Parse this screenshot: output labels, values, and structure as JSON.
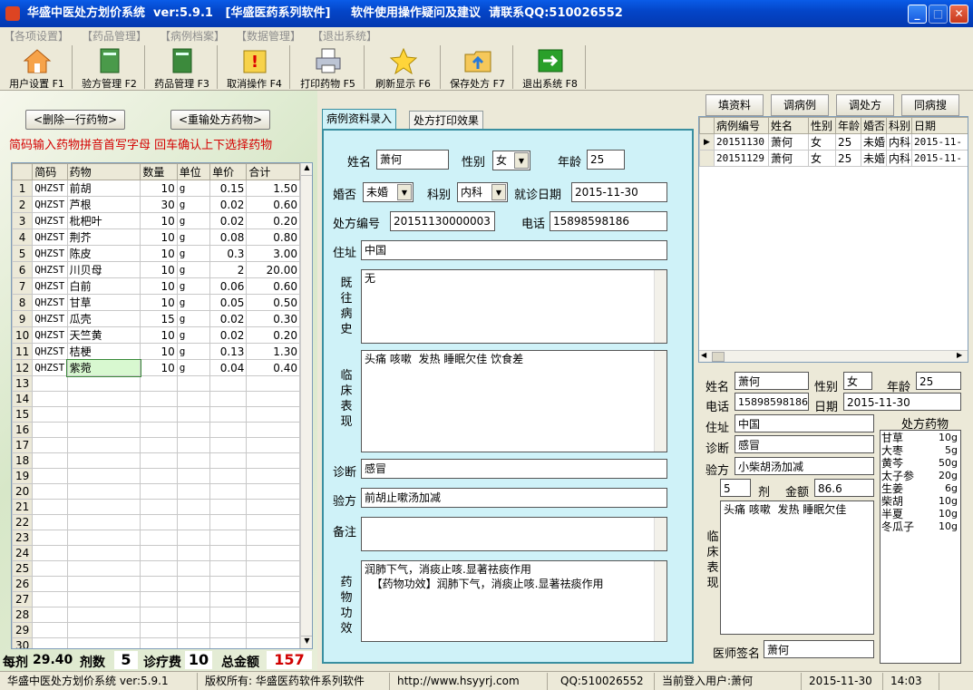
{
  "window": {
    "title": "华盛中医处方划价系统  ver:5.9.1   [华盛医药系列软件]     软件使用操作疑问及建议  请联系QQ:510026552"
  },
  "menu": [
    "【各项设置】",
    "【药品管理】",
    "【病例档案】",
    "【数据管理】",
    "【退出系统】"
  ],
  "toolbar": [
    {
      "label": "用户设置 F1",
      "icon": "home-icon"
    },
    {
      "label": "验方管理 F2",
      "icon": "book-icon"
    },
    {
      "label": "药品管理 F3",
      "icon": "book-icon"
    },
    {
      "label": "取消操作 F4",
      "icon": "warning-icon"
    },
    {
      "label": "打印药物 F5",
      "icon": "printer-icon"
    },
    {
      "label": "刷新显示 F6",
      "icon": "star-icon"
    },
    {
      "label": "保存处方 F7",
      "icon": "folder-icon"
    },
    {
      "label": "退出系统 F8",
      "icon": "exit-icon"
    }
  ],
  "left": {
    "delete_button": "<删除一行药物>",
    "reinput_button": "<重输处方药物>",
    "hint": "简码输入药物拼音首写字母  回车确认上下选择药物",
    "columns": [
      "简码",
      "药物",
      "数量",
      "单位",
      "单价",
      "合计"
    ],
    "rows": [
      {
        "no": "1",
        "code": "QHZST",
        "name": "前胡",
        "qty": "10",
        "unit": "g",
        "price": "0.15",
        "total": "1.50"
      },
      {
        "no": "2",
        "code": "QHZST",
        "name": "芦根",
        "qty": "30",
        "unit": "g",
        "price": "0.02",
        "total": "0.60"
      },
      {
        "no": "3",
        "code": "QHZST",
        "name": "枇杷叶",
        "qty": "10",
        "unit": "g",
        "price": "0.02",
        "total": "0.20"
      },
      {
        "no": "4",
        "code": "QHZST",
        "name": "荆芥",
        "qty": "10",
        "unit": "g",
        "price": "0.08",
        "total": "0.80"
      },
      {
        "no": "5",
        "code": "QHZST",
        "name": "陈皮",
        "qty": "10",
        "unit": "g",
        "price": "0.3",
        "total": "3.00"
      },
      {
        "no": "6",
        "code": "QHZST",
        "name": "川贝母",
        "qty": "10",
        "unit": "g",
        "price": "2",
        "total": "20.00"
      },
      {
        "no": "7",
        "code": "QHZST",
        "name": "白前",
        "qty": "10",
        "unit": "g",
        "price": "0.06",
        "total": "0.60"
      },
      {
        "no": "8",
        "code": "QHZST",
        "name": "甘草",
        "qty": "10",
        "unit": "g",
        "price": "0.05",
        "total": "0.50"
      },
      {
        "no": "9",
        "code": "QHZST",
        "name": "瓜壳",
        "qty": "15",
        "unit": "g",
        "price": "0.02",
        "total": "0.30"
      },
      {
        "no": "10",
        "code": "QHZST",
        "name": "天竺黄",
        "qty": "10",
        "unit": "g",
        "price": "0.02",
        "total": "0.20"
      },
      {
        "no": "11",
        "code": "QHZST",
        "name": "桔梗",
        "qty": "10",
        "unit": "g",
        "price": "0.13",
        "total": "1.30"
      },
      {
        "no": "12",
        "code": "QHZST",
        "name": "紫菀",
        "qty": "10",
        "unit": "g",
        "price": "0.04",
        "total": "0.40"
      }
    ],
    "empty_rows": [
      "13",
      "14",
      "15",
      "16",
      "17",
      "18",
      "19",
      "20",
      "21",
      "22",
      "23",
      "24",
      "25",
      "26",
      "27",
      "28",
      "29",
      "30"
    ],
    "totals": {
      "per_dose_label": "每剂",
      "per_dose": "29.40",
      "doses_label": "剂数",
      "doses": "5",
      "fee_label": "诊疗费",
      "fee": "10",
      "total_label": "总金额",
      "total": "157"
    }
  },
  "mid": {
    "tabs": [
      "病例资料录入",
      "处方打印效果"
    ],
    "labels": {
      "name": "姓名",
      "gender": "性别",
      "age": "年龄",
      "marital": "婚否",
      "dept": "科别",
      "date": "就诊日期",
      "rxno": "处方编号",
      "phone": "电话",
      "address": "住址",
      "history": "既往病史",
      "clinical": "临床表现",
      "diagnosis": "诊断",
      "formula": "验方",
      "remark": "备注",
      "effect": "药物功效"
    },
    "name": "萧何",
    "gender": "女",
    "age": "25",
    "marital": "未婚",
    "dept": "内科",
    "date": "2015-11-30",
    "rxno": "20151130000003",
    "phone": "15898598186",
    "address": "中国",
    "history": "无",
    "clinical": "头痛 咳嗽  发热 睡眠欠佳 饮食差",
    "diagnosis": "感冒",
    "formula": "前胡止嗽汤加减",
    "remark": "",
    "effect": "润肺下气，消痰止咳.显著祛痰作用\n  【药物功效】润肺下气，消痰止咳.显著祛痰作用"
  },
  "right": {
    "tabs": [
      "填资料",
      "调病例",
      "调处方",
      "同病搜"
    ],
    "columns": [
      "病例编号",
      "姓名",
      "性别",
      "年龄",
      "婚否",
      "科别",
      "日期"
    ],
    "rows": [
      {
        "id": "20151130",
        "name": "萧何",
        "gender": "女",
        "age": "25",
        "marital": "未婚",
        "dept": "内科",
        "date": "2015-11-"
      },
      {
        "id": "20151129",
        "name": "萧何",
        "gender": "女",
        "age": "25",
        "marital": "未婚",
        "dept": "内科",
        "date": "2015-11-"
      }
    ],
    "labels": {
      "name": "姓名",
      "gender": "性别",
      "age": "年龄",
      "phone": "电话",
      "date": "日期",
      "address": "住址",
      "diagnosis": "诊断",
      "formula": "验方",
      "doses_unit": "剂",
      "amount": "金额",
      "clinical": "临床表现",
      "doctor": "医师签名",
      "rx_drugs": "处方药物"
    },
    "name": "萧何",
    "gender": "女",
    "age": "25",
    "phone": "15898598186",
    "date": "2015-11-30",
    "address": "中国",
    "diagnosis": "感冒",
    "formula": "小柴胡汤加减",
    "doses": "5",
    "amount": "86.6",
    "clinical": "头痛 咳嗽  发热 睡眠欠佳",
    "doctor": "萧何",
    "drugs": [
      {
        "name": "甘草",
        "qty": "10g"
      },
      {
        "name": "大枣",
        "qty": "5g"
      },
      {
        "name": "黄芩",
        "qty": "50g"
      },
      {
        "name": "太子参",
        "qty": "20g"
      },
      {
        "name": "生姜",
        "qty": "6g"
      },
      {
        "name": "柴胡",
        "qty": "10g"
      },
      {
        "name": "半夏",
        "qty": "10g"
      },
      {
        "name": "冬瓜子",
        "qty": "10g"
      }
    ]
  },
  "status": {
    "app": "华盛中医处方划价系统 ver:5.9.1",
    "copyright": "版权所有: 华盛医药软件系列软件",
    "url": "http://www.hsyyrj.com",
    "qq": "QQ:510026552",
    "user": "当前登入用户:萧何",
    "date": "2015-11-30",
    "time": "14:03"
  }
}
